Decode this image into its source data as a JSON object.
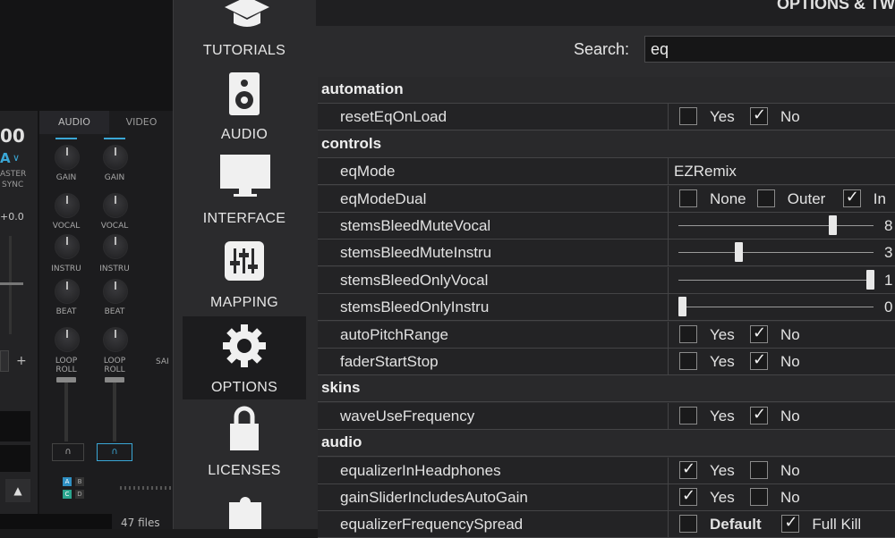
{
  "panel_title": "OPTIONS & TW",
  "search": {
    "label": "Search:",
    "value": "eq"
  },
  "nav": [
    {
      "label": "TUTORIALS",
      "icon": "graduation-cap-icon"
    },
    {
      "label": "AUDIO",
      "icon": "speaker-icon"
    },
    {
      "label": "INTERFACE",
      "icon": "monitor-icon"
    },
    {
      "label": "MAPPING",
      "icon": "sliders-icon"
    },
    {
      "label": "OPTIONS",
      "icon": "gear-icon",
      "selected": true
    },
    {
      "label": "LICENSES",
      "icon": "lock-icon"
    },
    {
      "label": "",
      "icon": "puzzle-icon"
    }
  ],
  "background": {
    "tab_audio": "AUDIO",
    "tab_video": "VIDEO",
    "bpm_fragment": "00",
    "deck_a": "A",
    "master": "ASTER",
    "sync": "SYNC",
    "pitch": "+0.0",
    "knobs": [
      "GAIN",
      "VOCAL",
      "INSTRU",
      "BEAT",
      "LOOP ROLL"
    ],
    "sam": "SAI",
    "plus": "+",
    "files": "47 files",
    "pads": [
      "A",
      "B",
      "C",
      "D"
    ]
  },
  "grid": {
    "categories": [
      {
        "title": "automation",
        "options": [
          {
            "name": "resetEqOnLoad",
            "type": "yesno",
            "yes": false,
            "no": true,
            "yes_label": "Yes",
            "no_label": "No"
          }
        ]
      },
      {
        "title": "controls",
        "options": [
          {
            "name": "eqMode",
            "type": "text",
            "value": "EZRemix"
          },
          {
            "name": "eqModeDual",
            "type": "multi",
            "choices": [
              {
                "label": "None",
                "on": false
              },
              {
                "label": "Outer",
                "on": false
              },
              {
                "label": "In",
                "on": true
              }
            ]
          },
          {
            "name": "stemsBleedMuteVocal",
            "type": "slider",
            "value": 0.8,
            "text": "8"
          },
          {
            "name": "stemsBleedMuteInstru",
            "type": "slider",
            "value": 0.3,
            "text": "3"
          },
          {
            "name": "stemsBleedOnlyVocal",
            "type": "slider",
            "value": 1.0,
            "text": "1"
          },
          {
            "name": "stemsBleedOnlyInstru",
            "type": "slider",
            "value": 0.0,
            "text": "0"
          },
          {
            "name": "autoPitchRange",
            "type": "yesno",
            "yes": false,
            "no": true,
            "yes_label": "Yes",
            "no_label": "No"
          },
          {
            "name": "faderStartStop",
            "type": "yesno",
            "yes": false,
            "no": true,
            "yes_label": "Yes",
            "no_label": "No"
          }
        ]
      },
      {
        "title": "skins",
        "options": [
          {
            "name": "waveUseFrequency",
            "type": "yesno",
            "yes": false,
            "no": true,
            "yes_label": "Yes",
            "no_label": "No"
          }
        ]
      },
      {
        "title": "audio",
        "options": [
          {
            "name": "equalizerInHeadphones",
            "type": "yesno",
            "yes": true,
            "no": false,
            "yes_label": "Yes",
            "no_label": "No"
          },
          {
            "name": "gainSliderIncludesAutoGain",
            "type": "yesno",
            "yes": true,
            "no": false,
            "yes_label": "Yes",
            "no_label": "No"
          },
          {
            "name": "equalizerFrequencySpread",
            "type": "multi",
            "choices": [
              {
                "label": "Default",
                "on": false,
                "bold": true
              },
              {
                "label": "Full Kill",
                "on": true
              }
            ]
          }
        ]
      }
    ]
  }
}
